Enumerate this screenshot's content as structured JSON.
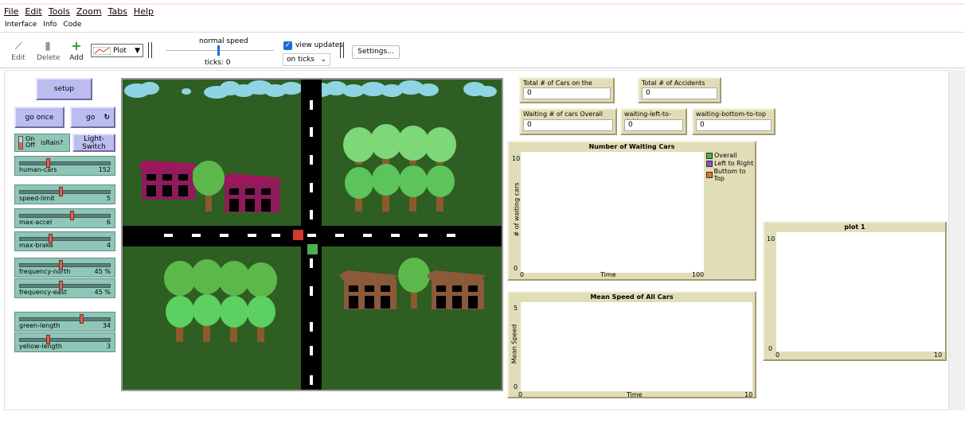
{
  "menu": [
    "File",
    "Edit",
    "Tools",
    "Zoom",
    "Tabs",
    "Help"
  ],
  "tabs": [
    "Interface",
    "Info",
    "Code"
  ],
  "toolbar": {
    "edit": "Edit",
    "delete": "Delete",
    "add": "Add",
    "widget_type": "Plot",
    "speed_label": "normal speed",
    "ticks": "ticks: 0",
    "view_updates": "view updates",
    "update_mode": "on ticks",
    "settings": "Settings..."
  },
  "buttons": {
    "setup": "setup",
    "go_once": "go once",
    "go": "go",
    "light_switch": "Light-Switch"
  },
  "switch": {
    "on": "On",
    "off": "Off",
    "name": "isRain?"
  },
  "sliders": [
    {
      "name": "human-cars",
      "value": "152",
      "level": 0.3
    },
    {
      "name": "speed-limit",
      "value": "5",
      "level": 0.45
    },
    {
      "name": "max-accel",
      "value": "6",
      "level": 0.57
    },
    {
      "name": "max-brake",
      "value": "4",
      "level": 0.33
    },
    {
      "name": "frequency-north",
      "value": "45 %",
      "level": 0.45
    },
    {
      "name": "frequency-east",
      "value": "45 %",
      "level": 0.45
    },
    {
      "name": "green-length",
      "value": "34",
      "level": 0.68
    },
    {
      "name": "yellow-length",
      "value": "3",
      "level": 0.3
    }
  ],
  "monitors": [
    {
      "label": "Total # of Cars on the roads",
      "value": "0"
    },
    {
      "label": "Total # of Accidents",
      "value": "0"
    },
    {
      "label": "Waiting # of cars Overall",
      "value": "0"
    },
    {
      "label": "waiting-left-to-right",
      "value": "0"
    },
    {
      "label": "waiting-bottom-to-top",
      "value": "0"
    }
  ],
  "plot_waiting": {
    "title": "Number of Waiting Cars",
    "xlabel": "Time",
    "ylabel": "# of waiting cars",
    "xmin": "0",
    "xmax": "100",
    "ymin": "0",
    "ymax": "10",
    "legend": [
      {
        "name": "Overall",
        "color": "#4caf50"
      },
      {
        "name": "Left to Right",
        "color": "#8a4fc8"
      },
      {
        "name": "Buttom to Top",
        "color": "#e8731a"
      }
    ]
  },
  "plot_speed": {
    "title": "Mean Speed of All Cars",
    "xlabel": "Time",
    "ylabel": "Mean Speed",
    "xmin": "0",
    "xmax": "10",
    "ymin": "0",
    "ymax": "5"
  },
  "plot_1": {
    "title": "plot 1",
    "xmin": "0",
    "xmax": "10",
    "ymin": "0",
    "ymax": "10"
  }
}
